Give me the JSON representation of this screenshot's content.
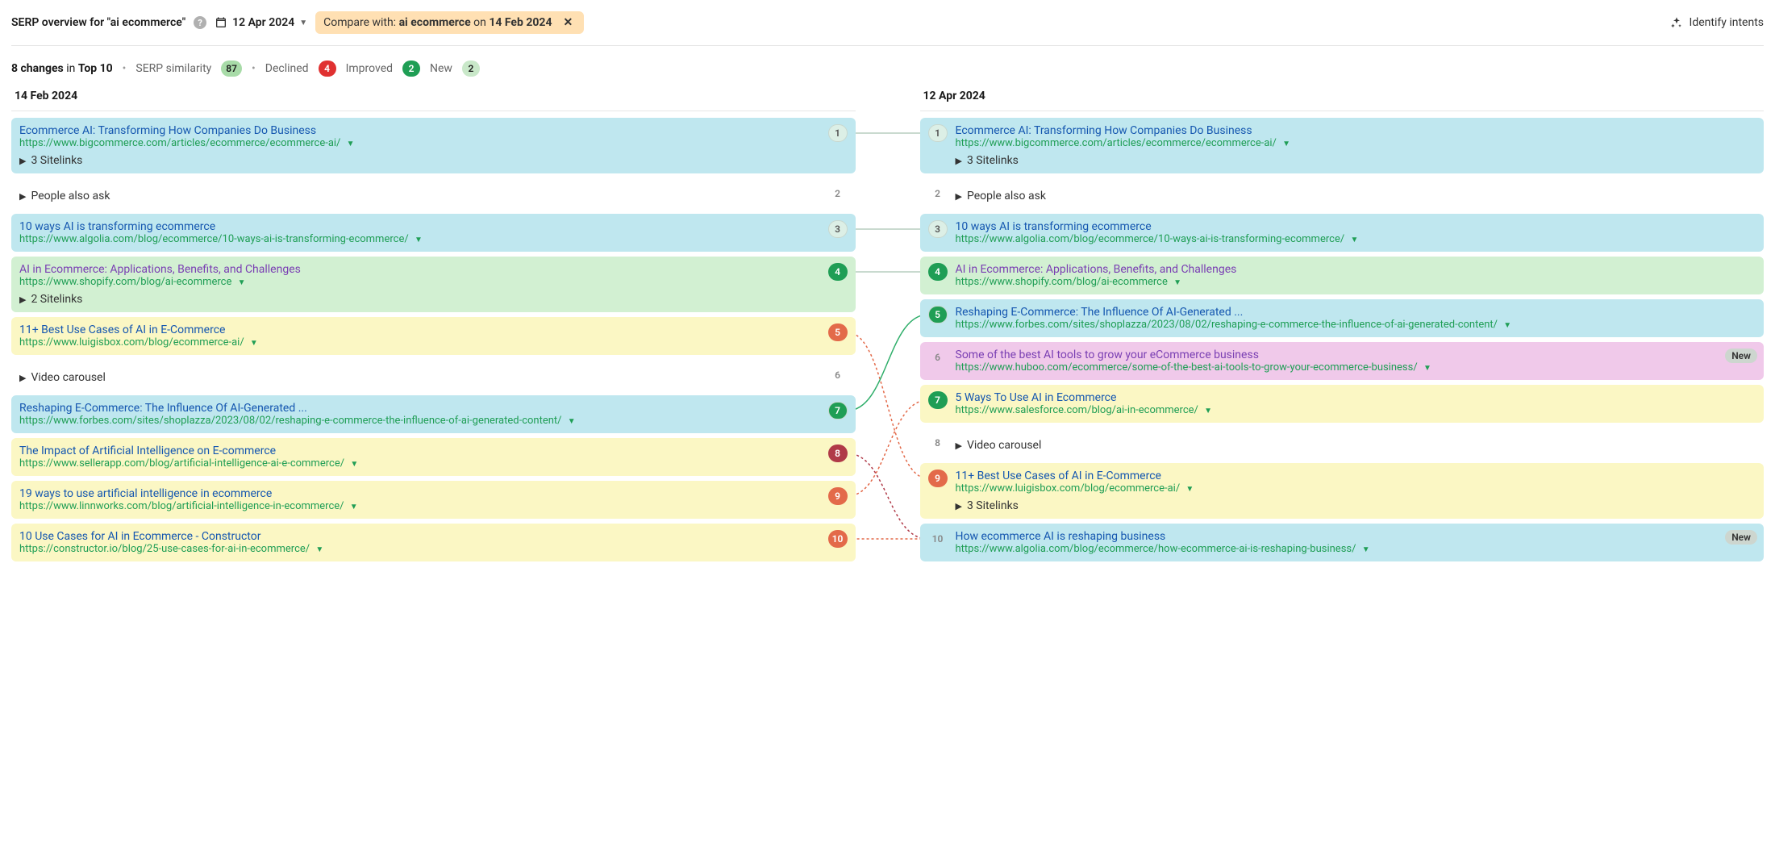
{
  "topbar": {
    "title_prefix": "SERP overview for ",
    "keyword": "ai ecommerce",
    "date": "12 Apr 2024",
    "compare_prefix": "Compare with: ",
    "compare_kw": "ai ecommerce",
    "compare_on": " on ",
    "compare_date": "14 Feb 2024",
    "identify_label": "Identify intents"
  },
  "summary": {
    "changes_count": "8 changes",
    "changes_scope": " in ",
    "top_scope": "Top 10",
    "similarity_label": "SERP similarity",
    "similarity_value": "87",
    "declined_label": "Declined",
    "declined_value": "4",
    "improved_label": "Improved",
    "improved_value": "2",
    "new_label": "New",
    "new_value": "2"
  },
  "cols": {
    "left_header": "14 Feb 2024",
    "right_header": "12 Apr 2024"
  },
  "extras": {
    "sitelinks3": "3 Sitelinks",
    "sitelinks2": "2 Sitelinks",
    "paa": "People also ask",
    "video": "Video carousel",
    "new_badge": "New"
  },
  "left": [
    {
      "rank": "1",
      "status": "stable",
      "title": "Ecommerce AI: Transforming How Companies Do Business",
      "url": "https://www.bigcommerce.com/articles/ecommerce/ecommerce-ai/",
      "extra": "sitelinks3"
    },
    {
      "rank": "2",
      "status": "feature",
      "title": "",
      "url": "",
      "extra": "paa"
    },
    {
      "rank": "3",
      "status": "stable",
      "title": "10 ways AI is transforming ecommerce",
      "url": "https://www.algolia.com/blog/ecommerce/10-ways-ai-is-transforming-ecommerce/"
    },
    {
      "rank": "4",
      "status": "improved",
      "title": "AI in Ecommerce: Applications, Benefits, and Challenges",
      "url": "https://www.shopify.com/blog/ai-ecommerce",
      "extra": "sitelinks2"
    },
    {
      "rank": "5",
      "status": "declined",
      "title": "11+ Best Use Cases of AI in E-Commerce",
      "url": "https://www.luigisbox.com/blog/ecommerce-ai/"
    },
    {
      "rank": "6",
      "status": "feature",
      "title": "",
      "url": "",
      "extra": "video"
    },
    {
      "rank": "7",
      "status": "stable",
      "title": "Reshaping E-Commerce: The Influence Of AI-Generated ...",
      "url": "https://www.forbes.com/sites/shoplazza/2023/08/02/reshaping-e-commerce-the-influence-of-ai-generated-content/",
      "improved_rank": true
    },
    {
      "rank": "8",
      "status": "lost",
      "title": "The Impact of Artificial Intelligence on E-commerce",
      "url": "https://www.sellerapp.com/blog/artificial-intelligence-ai-e-commerce/"
    },
    {
      "rank": "9",
      "status": "declined",
      "title": "19 ways to use artificial intelligence in ecommerce",
      "url": "https://www.linnworks.com/blog/artificial-intelligence-in-ecommerce/"
    },
    {
      "rank": "10",
      "status": "declined",
      "title": "10 Use Cases for AI in Ecommerce - Constructor",
      "url": "https://constructor.io/blog/25-use-cases-for-ai-in-ecommerce/"
    }
  ],
  "right": [
    {
      "rank": "1",
      "status": "stable",
      "title": "Ecommerce AI: Transforming How Companies Do Business",
      "url": "https://www.bigcommerce.com/articles/ecommerce/ecommerce-ai/",
      "extra": "sitelinks3"
    },
    {
      "rank": "2",
      "status": "feature",
      "title": "",
      "url": "",
      "extra": "paa"
    },
    {
      "rank": "3",
      "status": "stable",
      "title": "10 ways AI is transforming ecommerce",
      "url": "https://www.algolia.com/blog/ecommerce/10-ways-ai-is-transforming-ecommerce/"
    },
    {
      "rank": "4",
      "status": "improved",
      "title": "AI in Ecommerce: Applications, Benefits, and Challenges",
      "url": "https://www.shopify.com/blog/ai-ecommerce"
    },
    {
      "rank": "5",
      "status": "stable",
      "title": "Reshaping E-Commerce: The Influence Of AI-Generated ...",
      "url": "https://www.forbes.com/sites/shoplazza/2023/08/02/reshaping-e-commerce-the-influence-of-ai-generated-content/",
      "improved_rank": true
    },
    {
      "rank": "6",
      "status": "newc",
      "title": "Some of the best AI tools to grow your eCommerce business",
      "url": "https://www.huboo.com/ecommerce/some-of-the-best-ai-tools-to-grow-your-ecommerce-business/",
      "new": true
    },
    {
      "rank": "7",
      "status": "declined",
      "title": "5 Ways To Use AI in Ecommerce",
      "url": "https://www.salesforce.com/blog/ai-in-ecommerce/",
      "improved_rank": true
    },
    {
      "rank": "8",
      "status": "feature",
      "title": "",
      "url": "",
      "extra": "video"
    },
    {
      "rank": "9",
      "status": "declined",
      "title": "11+ Best Use Cases of AI in E-Commerce",
      "url": "https://www.luigisbox.com/blog/ecommerce-ai/",
      "extra": "sitelinks3"
    },
    {
      "rank": "10",
      "status": "newblue",
      "title": "How ecommerce AI is reshaping business",
      "url": "https://www.algolia.com/blog/ecommerce/how-ecommerce-ai-is-reshaping-business/",
      "new": true
    }
  ]
}
